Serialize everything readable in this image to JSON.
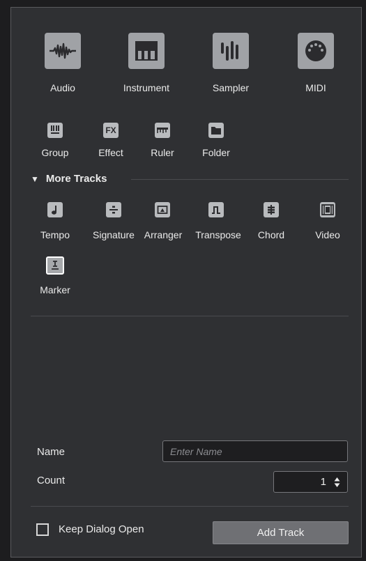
{
  "primary_tracks": [
    {
      "label": "Audio",
      "icon": "audio-waveform-icon"
    },
    {
      "label": "Instrument",
      "icon": "piano-keys-icon"
    },
    {
      "label": "Sampler",
      "icon": "sampler-bars-icon"
    },
    {
      "label": "MIDI",
      "icon": "midi-connector-icon"
    }
  ],
  "secondary_tracks": [
    {
      "label": "Group",
      "icon": "group-icon"
    },
    {
      "label": "Effect",
      "icon": "fx-icon",
      "glyph": "FX"
    },
    {
      "label": "Ruler",
      "icon": "ruler-icon"
    },
    {
      "label": "Folder",
      "icon": "folder-icon"
    }
  ],
  "more_tracks": {
    "title": "More Tracks",
    "expanded_glyph": "▼",
    "items": [
      {
        "label": "Tempo",
        "icon": "tempo-note-icon"
      },
      {
        "label": "Signature",
        "icon": "signature-divide-icon"
      },
      {
        "label": "Arranger",
        "icon": "arranger-icon"
      },
      {
        "label": "Transpose",
        "icon": "transpose-icon"
      },
      {
        "label": "Chord",
        "icon": "chord-icon"
      },
      {
        "label": "Video",
        "icon": "video-film-icon"
      },
      {
        "label": "Marker",
        "icon": "marker-icon"
      }
    ]
  },
  "form": {
    "name_label": "Name",
    "name_placeholder": "Enter Name",
    "name_value": "",
    "count_label": "Count",
    "count_value": "1"
  },
  "footer": {
    "keep_open_label": "Keep Dialog Open",
    "keep_open_checked": false,
    "add_button_label": "Add Track"
  },
  "colors": {
    "panel_bg": "#2f3033",
    "tile_bg": "#a0a2a6",
    "icon_fg": "#2b2b2e"
  }
}
